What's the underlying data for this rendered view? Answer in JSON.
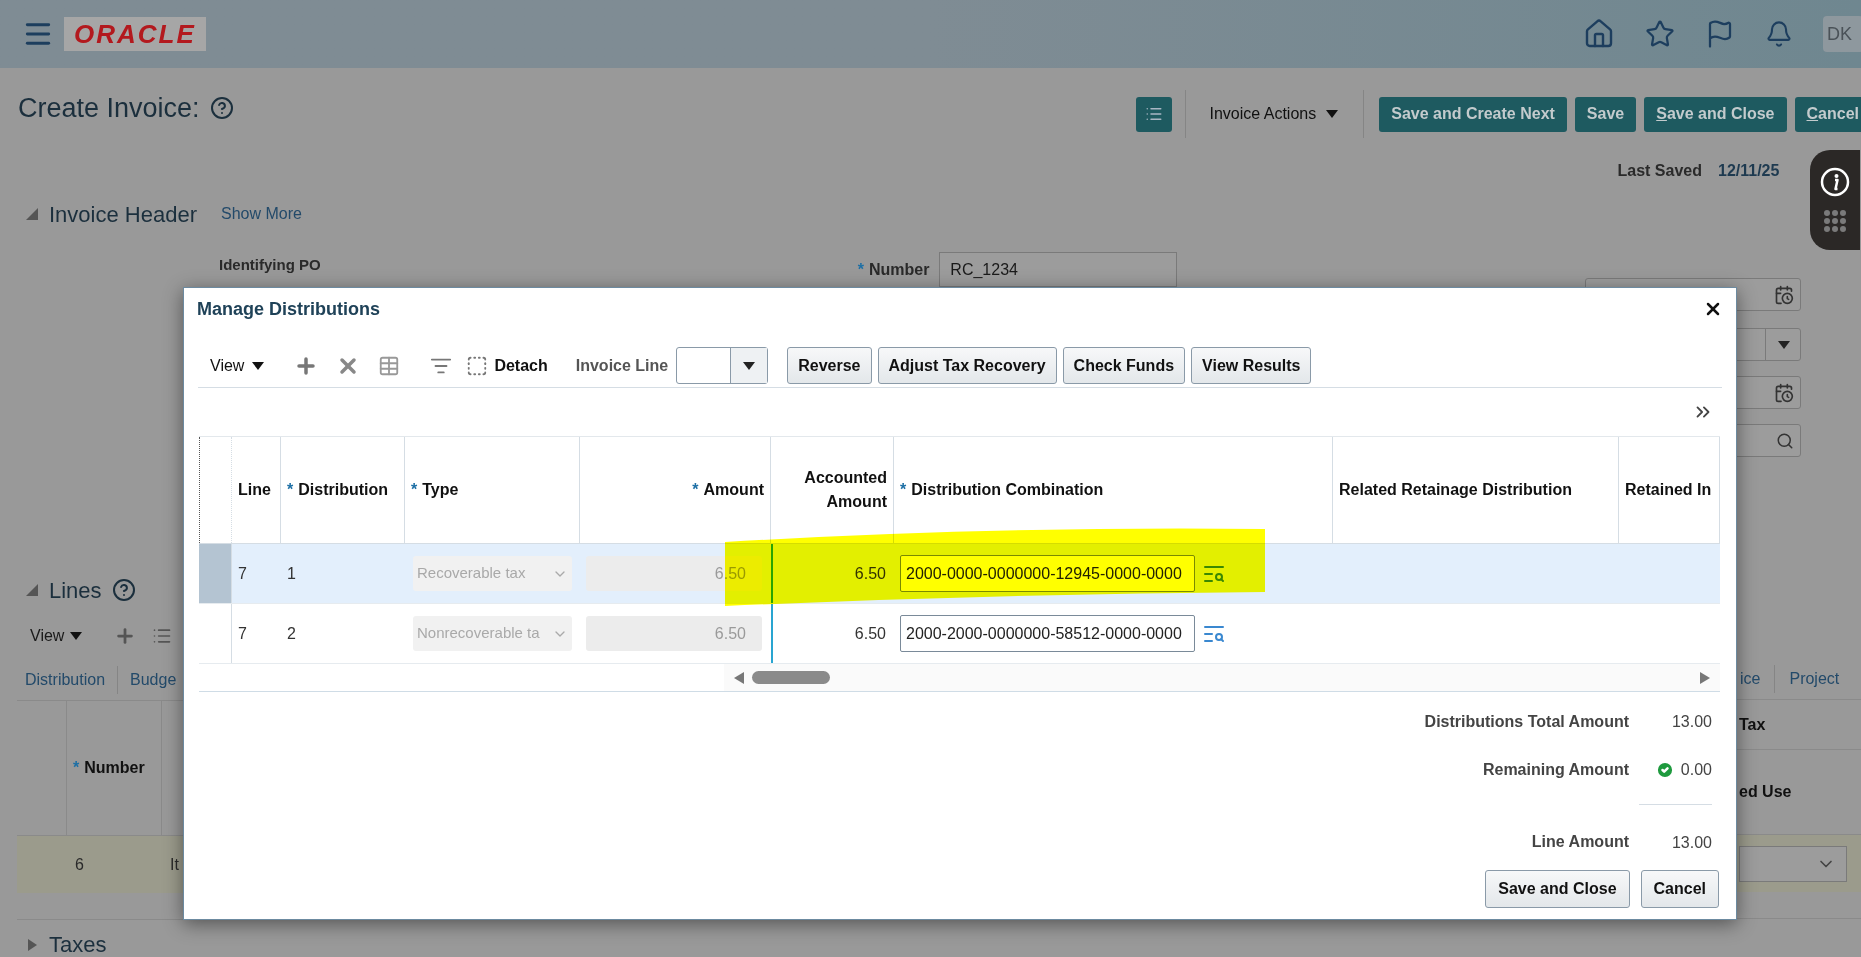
{
  "top_bar": {
    "logo": "ORACLE",
    "user_initials": "DK"
  },
  "page_header": {
    "title": "Create Invoice:",
    "actions_menu": "Invoice Actions",
    "buttons": [
      {
        "label": "Save and Create Next",
        "underline_first": false
      },
      {
        "label": "Save",
        "underline_first": false
      },
      {
        "label": "Save and Close",
        "underline_first": true
      },
      {
        "label": "Cancel",
        "underline_first": true
      }
    ]
  },
  "last_saved": {
    "label": "Last Saved",
    "value": "12/11/25"
  },
  "invoice_header": {
    "title": "Invoice Header",
    "expanded": true,
    "link": "Show More",
    "identifying_po_label": "Identifying PO",
    "number": {
      "label": "Number",
      "required_mark": "*",
      "value": "RC_1234"
    }
  },
  "lines": {
    "title": "Lines",
    "expanded": true,
    "view_menu": "View",
    "left_tabs": [
      "Distribution",
      "Budge"
    ],
    "right_tabs": [
      "ice",
      "Project"
    ],
    "left_column": {
      "label": "Number",
      "required_mark": "*"
    },
    "right_headers": [
      "Tax",
      "ed Use"
    ],
    "row": {
      "number": "6",
      "column_2": "It"
    }
  },
  "taxes": {
    "title": "Taxes",
    "expanded": false
  },
  "dialog": {
    "title": "Manage Distributions",
    "toolbar": {
      "view_menu": "View",
      "detach": "Detach",
      "invoice_line_label": "Invoice Line",
      "buttons": [
        "Reverse",
        "Adjust Tax Recovery",
        "Check Funds",
        "View Results"
      ]
    },
    "columns": [
      {
        "label": "Line"
      },
      {
        "label": "Distribution",
        "required_mark": "*"
      },
      {
        "label": "Type",
        "required_mark": "*"
      },
      {
        "label": "Amount",
        "required_mark": "*"
      },
      {
        "label": "Accounted Amount"
      },
      {
        "label": "Distribution Combination",
        "required_mark": "*"
      },
      {
        "label": "Related Retainage Distribution"
      },
      {
        "label": "Retained In"
      }
    ],
    "rows": [
      {
        "line": "7",
        "distribution": "1",
        "type": "Recoverable tax",
        "amount": "6.50",
        "accounted_amount": "6.50",
        "distribution_combination": "2000-0000-0000000-12945-0000-0000",
        "locked": true,
        "selected": true
      },
      {
        "line": "7",
        "distribution": "2",
        "type": "Nonrecoverable ta",
        "amount": "6.50",
        "accounted_amount": "6.50",
        "distribution_combination": "2000-2000-0000000-58512-0000-0000",
        "locked": true,
        "selected": false
      }
    ],
    "totals": [
      {
        "label": "Distributions Total Amount",
        "value": "13.00",
        "kind": "plain"
      },
      {
        "label": "Remaining Amount",
        "value": "0.00",
        "kind": "balanced"
      },
      {
        "label": "Line Amount",
        "value": "13.00",
        "kind": "plain"
      }
    ],
    "buttons": [
      "Save and Close",
      "Cancel"
    ]
  }
}
